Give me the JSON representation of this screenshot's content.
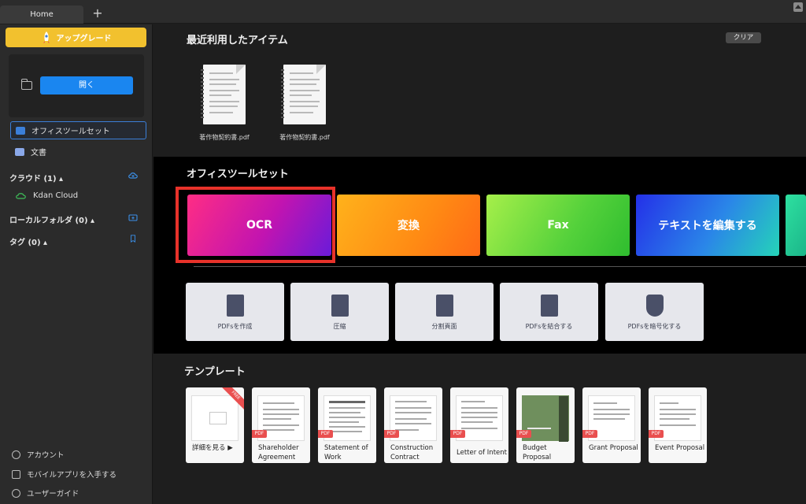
{
  "tabs": [
    {
      "label": "Home"
    }
  ],
  "tab_add": "+",
  "sidebar": {
    "upgrade_label": "アップグレード",
    "open_label": "開く",
    "nav": [
      {
        "label": "オフィスツールセット",
        "active": true
      },
      {
        "label": "文書",
        "active": false
      }
    ],
    "cloud_section": "クラウド (1) ▴",
    "cloud_item": "Kdan Cloud",
    "local_section": "ローカルフォルダ (0) ▴",
    "tag_section": "タグ (0) ▴",
    "bottom": [
      {
        "label": "アカウント",
        "icon": "person-icon"
      },
      {
        "label": "モバイルアプリを入手する",
        "icon": "mobile-icon"
      },
      {
        "label": "ユーザーガイド",
        "icon": "help-icon"
      }
    ]
  },
  "recent": {
    "title": "最近利用したアイテム",
    "clear_label": "クリア",
    "items": [
      {
        "name": "著作物契約書.pdf"
      },
      {
        "name": "著作物契約書.pdf"
      }
    ]
  },
  "toolset": {
    "title": "オフィスツールセット",
    "banners": [
      {
        "label": "OCR"
      },
      {
        "label": "変換"
      },
      {
        "label": "Fax"
      },
      {
        "label": "テキストを編集する"
      }
    ],
    "tools": [
      {
        "label": "PDFsを作成",
        "icon": "create-pdf-icon"
      },
      {
        "label": "圧縮",
        "icon": "compress-icon"
      },
      {
        "label": "分割頁面",
        "icon": "split-icon"
      },
      {
        "label": "PDFsを結合する",
        "icon": "merge-icon"
      },
      {
        "label": "PDFsを暗号化する",
        "icon": "encrypt-icon"
      }
    ]
  },
  "templates": {
    "title": "テンプレート",
    "free_badge": "FREE",
    "pdf_badge": "PDF",
    "items": [
      {
        "label": "詳細を見る ▶"
      },
      {
        "label": "Shareholder Agreement"
      },
      {
        "label": "Statement of Work"
      },
      {
        "label": "Construction Contract"
      },
      {
        "label": "Letter of Intent"
      },
      {
        "label": "Budget Proposal"
      },
      {
        "label": "Grant Proposal"
      },
      {
        "label": "Event Proposal"
      }
    ]
  },
  "colors": {
    "accent": "#1a86f0",
    "upgrade": "#f2c12e",
    "highlight": "#e8322a"
  }
}
